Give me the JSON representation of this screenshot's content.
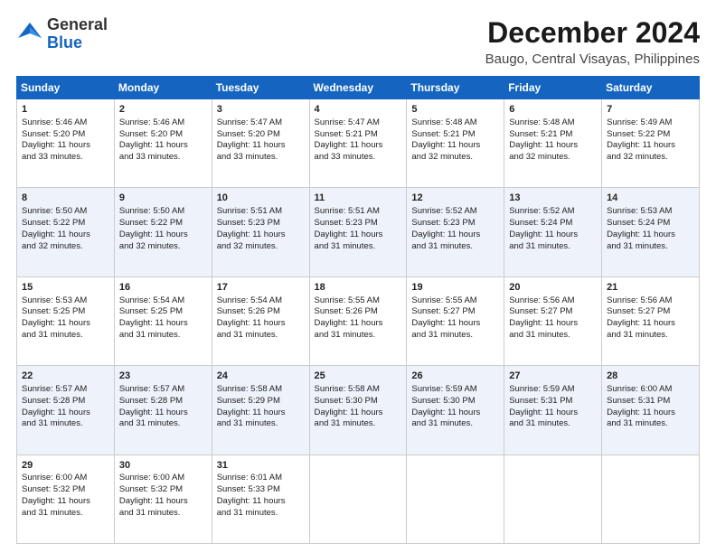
{
  "header": {
    "logo_general": "General",
    "logo_blue": "Blue",
    "title": "December 2024",
    "subtitle": "Baugo, Central Visayas, Philippines"
  },
  "calendar": {
    "headers": [
      "Sunday",
      "Monday",
      "Tuesday",
      "Wednesday",
      "Thursday",
      "Friday",
      "Saturday"
    ],
    "weeks": [
      [
        {
          "day": "",
          "content": ""
        },
        {
          "day": "2",
          "content": "Sunrise: 5:46 AM\nSunset: 5:20 PM\nDaylight: 11 hours\nand 33 minutes."
        },
        {
          "day": "3",
          "content": "Sunrise: 5:47 AM\nSunset: 5:20 PM\nDaylight: 11 hours\nand 33 minutes."
        },
        {
          "day": "4",
          "content": "Sunrise: 5:47 AM\nSunset: 5:21 PM\nDaylight: 11 hours\nand 33 minutes."
        },
        {
          "day": "5",
          "content": "Sunrise: 5:48 AM\nSunset: 5:21 PM\nDaylight: 11 hours\nand 32 minutes."
        },
        {
          "day": "6",
          "content": "Sunrise: 5:48 AM\nSunset: 5:21 PM\nDaylight: 11 hours\nand 32 minutes."
        },
        {
          "day": "7",
          "content": "Sunrise: 5:49 AM\nSunset: 5:22 PM\nDaylight: 11 hours\nand 32 minutes."
        }
      ],
      [
        {
          "day": "1",
          "content": "Sunrise: 5:46 AM\nSunset: 5:20 PM\nDaylight: 11 hours\nand 33 minutes."
        },
        {
          "day": "9",
          "content": "Sunrise: 5:50 AM\nSunset: 5:22 PM\nDaylight: 11 hours\nand 32 minutes."
        },
        {
          "day": "10",
          "content": "Sunrise: 5:51 AM\nSunset: 5:23 PM\nDaylight: 11 hours\nand 32 minutes."
        },
        {
          "day": "11",
          "content": "Sunrise: 5:51 AM\nSunset: 5:23 PM\nDaylight: 11 hours\nand 31 minutes."
        },
        {
          "day": "12",
          "content": "Sunrise: 5:52 AM\nSunset: 5:23 PM\nDaylight: 11 hours\nand 31 minutes."
        },
        {
          "day": "13",
          "content": "Sunrise: 5:52 AM\nSunset: 5:24 PM\nDaylight: 11 hours\nand 31 minutes."
        },
        {
          "day": "14",
          "content": "Sunrise: 5:53 AM\nSunset: 5:24 PM\nDaylight: 11 hours\nand 31 minutes."
        }
      ],
      [
        {
          "day": "8",
          "content": "Sunrise: 5:50 AM\nSunset: 5:22 PM\nDaylight: 11 hours\nand 32 minutes."
        },
        {
          "day": "16",
          "content": "Sunrise: 5:54 AM\nSunset: 5:25 PM\nDaylight: 11 hours\nand 31 minutes."
        },
        {
          "day": "17",
          "content": "Sunrise: 5:54 AM\nSunset: 5:26 PM\nDaylight: 11 hours\nand 31 minutes."
        },
        {
          "day": "18",
          "content": "Sunrise: 5:55 AM\nSunset: 5:26 PM\nDaylight: 11 hours\nand 31 minutes."
        },
        {
          "day": "19",
          "content": "Sunrise: 5:55 AM\nSunset: 5:27 PM\nDaylight: 11 hours\nand 31 minutes."
        },
        {
          "day": "20",
          "content": "Sunrise: 5:56 AM\nSunset: 5:27 PM\nDaylight: 11 hours\nand 31 minutes."
        },
        {
          "day": "21",
          "content": "Sunrise: 5:56 AM\nSunset: 5:27 PM\nDaylight: 11 hours\nand 31 minutes."
        }
      ],
      [
        {
          "day": "15",
          "content": "Sunrise: 5:53 AM\nSunset: 5:25 PM\nDaylight: 11 hours\nand 31 minutes."
        },
        {
          "day": "23",
          "content": "Sunrise: 5:57 AM\nSunset: 5:28 PM\nDaylight: 11 hours\nand 31 minutes."
        },
        {
          "day": "24",
          "content": "Sunrise: 5:58 AM\nSunset: 5:29 PM\nDaylight: 11 hours\nand 31 minutes."
        },
        {
          "day": "25",
          "content": "Sunrise: 5:58 AM\nSunset: 5:30 PM\nDaylight: 11 hours\nand 31 minutes."
        },
        {
          "day": "26",
          "content": "Sunrise: 5:59 AM\nSunset: 5:30 PM\nDaylight: 11 hours\nand 31 minutes."
        },
        {
          "day": "27",
          "content": "Sunrise: 5:59 AM\nSunset: 5:31 PM\nDaylight: 11 hours\nand 31 minutes."
        },
        {
          "day": "28",
          "content": "Sunrise: 6:00 AM\nSunset: 5:31 PM\nDaylight: 11 hours\nand 31 minutes."
        }
      ],
      [
        {
          "day": "22",
          "content": "Sunrise: 5:57 AM\nSunset: 5:28 PM\nDaylight: 11 hours\nand 31 minutes."
        },
        {
          "day": "30",
          "content": "Sunrise: 6:00 AM\nSunset: 5:32 PM\nDaylight: 11 hours\nand 31 minutes."
        },
        {
          "day": "31",
          "content": "Sunrise: 6:01 AM\nSunset: 5:33 PM\nDaylight: 11 hours\nand 31 minutes."
        },
        {
          "day": "",
          "content": ""
        },
        {
          "day": "",
          "content": ""
        },
        {
          "day": "",
          "content": ""
        },
        {
          "day": "",
          "content": ""
        }
      ],
      [
        {
          "day": "29",
          "content": "Sunrise: 6:00 AM\nSunset: 5:32 PM\nDaylight: 11 hours\nand 31 minutes."
        },
        {
          "day": "",
          "content": ""
        },
        {
          "day": "",
          "content": ""
        },
        {
          "day": "",
          "content": ""
        },
        {
          "day": "",
          "content": ""
        },
        {
          "day": "",
          "content": ""
        },
        {
          "day": "",
          "content": ""
        }
      ]
    ]
  }
}
